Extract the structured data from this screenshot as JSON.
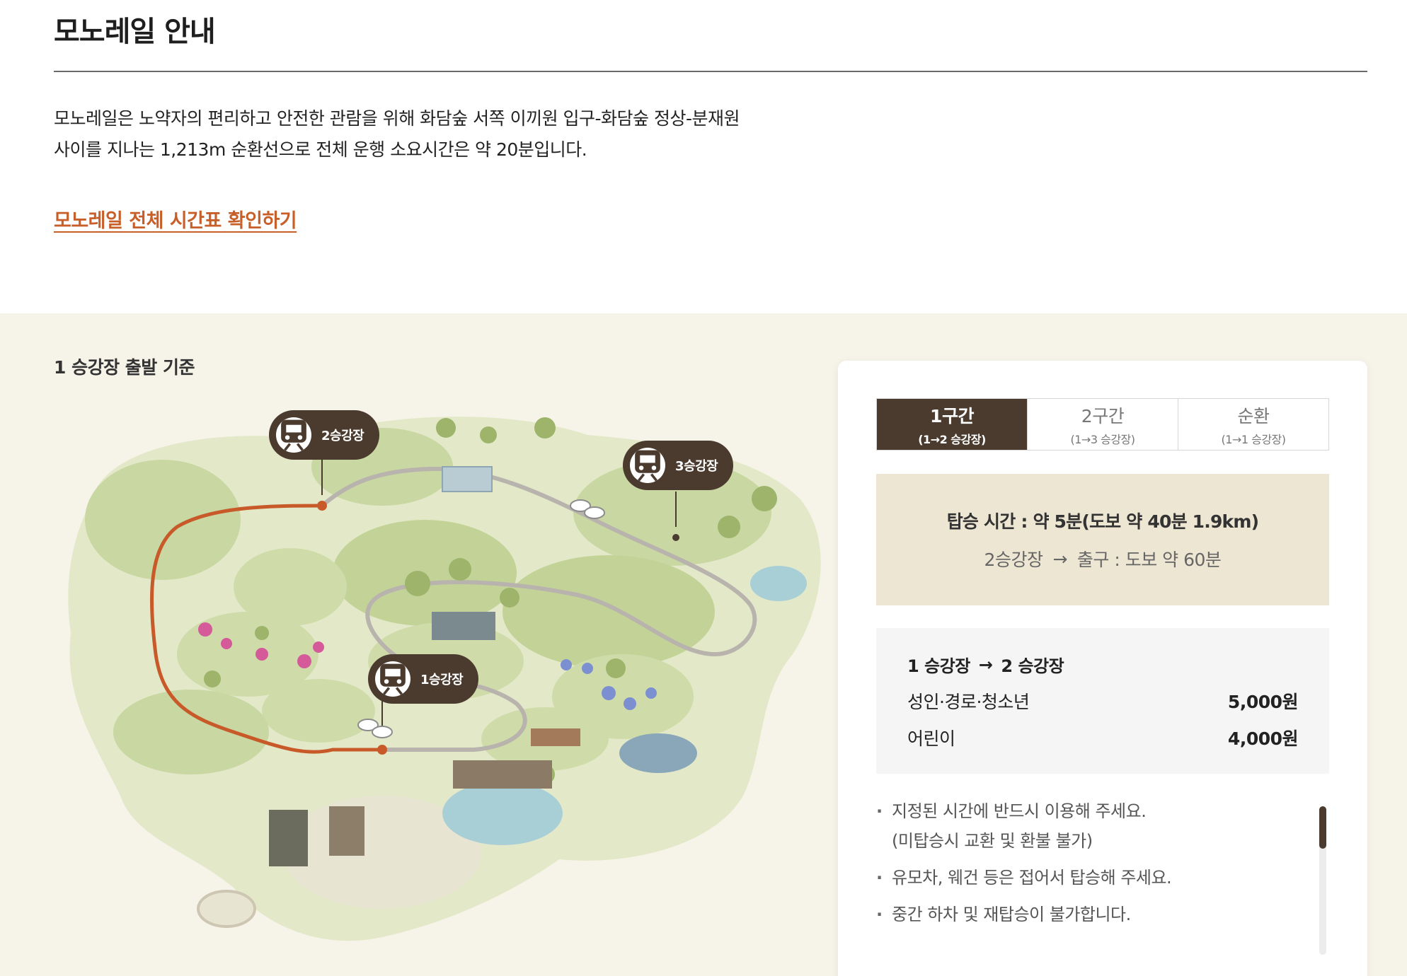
{
  "header": {
    "title": "모노레일 안내"
  },
  "intro": {
    "line1": "모노레일은 노약자의 편리하고 안전한 관람을 위해 화담숲 서쪽 이끼원 입구-화담숲 정상-분재원",
    "line2": "사이를 지나는 1,213m 순환선으로 전체 운행 소요시간은 약 20분입니다."
  },
  "timetable_link": "모노레일 전체 시간표 확인하기",
  "map": {
    "caption": "1 승강장 출발 기준",
    "stations": [
      {
        "label": "1승강장"
      },
      {
        "label": "2승강장"
      },
      {
        "label": "3승강장"
      }
    ],
    "colors": {
      "route_active": "#c85a2a",
      "route_track": "#b8b4ad",
      "land": "#d8e2b8",
      "land_dark": "#b4c88a",
      "pin": "#4b3a2e"
    }
  },
  "panel": {
    "tabs": [
      {
        "name": "1구간",
        "sub": "(1→2 승강장)",
        "active": true
      },
      {
        "name": "2구간",
        "sub": "(1→3 승강장)",
        "active": false
      },
      {
        "name": "순환",
        "sub": "(1→1 승강장)",
        "active": false
      }
    ],
    "ride": {
      "time": "탑승 시간 : 약 5분(도보 약 40분 1.9km)",
      "walk_from": "2승강장",
      "walk_arrow": "→",
      "walk_to": "출구 : 도보 약 60분"
    },
    "fare": {
      "from": "1 승강장",
      "arrow": "→",
      "to": "2 승강장",
      "rows": [
        {
          "label": "성인·경로·청소년",
          "price": "5,000원"
        },
        {
          "label": "어린이",
          "price": "4,000원"
        }
      ]
    },
    "notes": [
      {
        "text": "지정된 시간에 반드시 이용해 주세요.",
        "sub": "(미탑승시 교환 및 환불 불가)"
      },
      {
        "text": "유모차, 웨건 등은 접어서 탑승해 주세요.",
        "sub": ""
      },
      {
        "text": "중간 하차 및 재탑승이 불가합니다.",
        "sub": ""
      }
    ]
  }
}
